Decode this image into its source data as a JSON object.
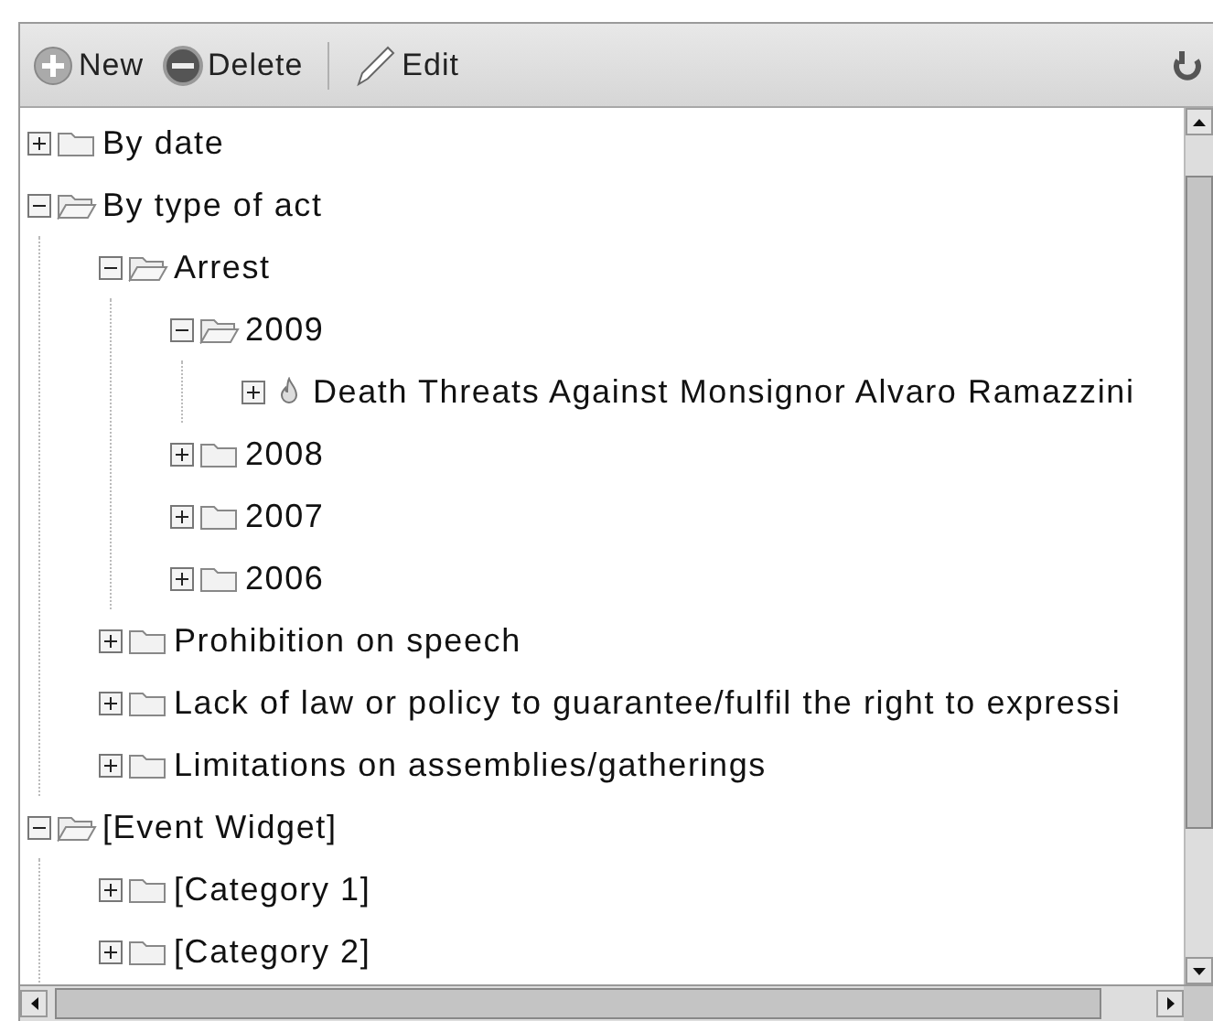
{
  "toolbar": {
    "buttons": [
      {
        "kind": "new",
        "label": "New"
      },
      {
        "kind": "delete",
        "label": "Delete"
      },
      {
        "kind": "edit",
        "label": "Edit"
      }
    ]
  },
  "tree": [
    {
      "kind": "folder",
      "label": "By date",
      "expanded": false
    },
    {
      "kind": "folder",
      "label": "By type of act",
      "expanded": true,
      "children": [
        {
          "kind": "folder",
          "label": "Arrest",
          "expanded": true,
          "children": [
            {
              "kind": "folder",
              "label": "2009",
              "expanded": true,
              "children": [
                {
                  "kind": "item",
                  "label": "Death Threats Against Monsignor Alvaro Ramazzini",
                  "expanded": false
                }
              ]
            },
            {
              "kind": "folder",
              "label": "2008",
              "expanded": false
            },
            {
              "kind": "folder",
              "label": "2007",
              "expanded": false
            },
            {
              "kind": "folder",
              "label": "2006",
              "expanded": false
            }
          ]
        },
        {
          "kind": "folder",
          "label": "Prohibition on speech",
          "expanded": false
        },
        {
          "kind": "folder",
          "label": "Lack of law or policy to guarantee/fulfil the right to expressi",
          "expanded": false
        },
        {
          "kind": "folder",
          "label": "Limitations on assemblies/gatherings",
          "expanded": false
        }
      ]
    },
    {
      "kind": "folder",
      "label": "[Event Widget]",
      "expanded": true,
      "children": [
        {
          "kind": "folder",
          "label": "[Category 1]",
          "expanded": false
        },
        {
          "kind": "folder",
          "label": "[Category 2]",
          "expanded": false
        }
      ]
    }
  ]
}
